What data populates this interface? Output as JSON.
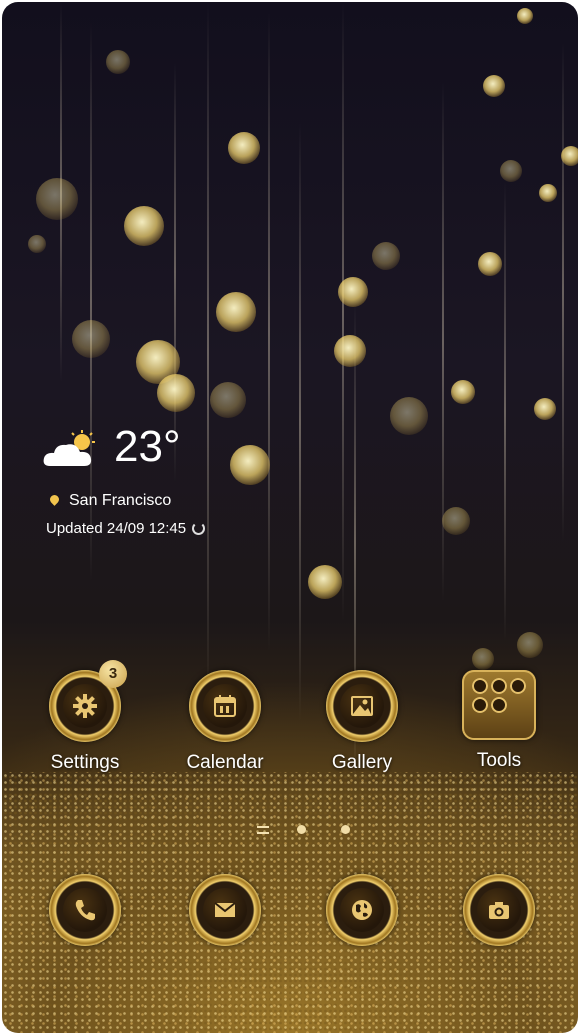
{
  "weather": {
    "temperature": "23°",
    "location": "San Francisco",
    "updated": "Updated 24/09 12:45",
    "icon": "partly-cloudy-icon"
  },
  "apps": [
    {
      "label": "Settings",
      "icon": "gear-icon",
      "badge": "3"
    },
    {
      "label": "Calendar",
      "icon": "calendar-icon"
    },
    {
      "label": "Gallery",
      "icon": "image-icon"
    },
    {
      "label": "Tools",
      "icon": "folder-grid-icon"
    }
  ],
  "dock": [
    {
      "icon": "phone-icon"
    },
    {
      "icon": "mail-icon"
    },
    {
      "icon": "globe-icon"
    },
    {
      "icon": "camera-icon"
    }
  ],
  "pager": {
    "pages": 3,
    "current": "home"
  },
  "colors": {
    "gold": "#d9b04f",
    "dark": "#1b1623"
  }
}
